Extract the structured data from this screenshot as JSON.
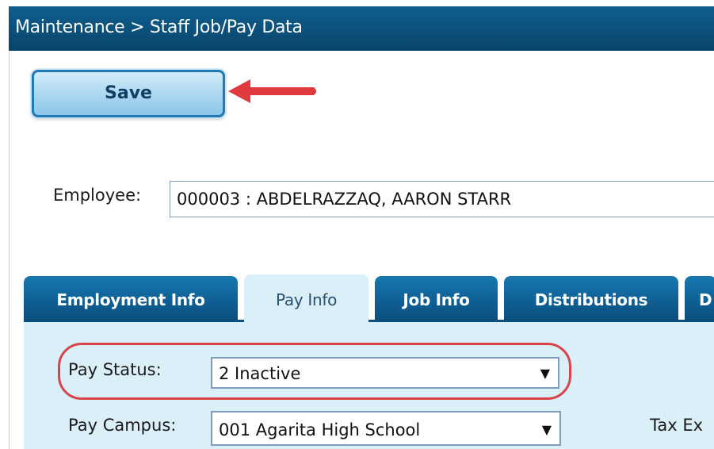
{
  "titlebar": {
    "breadcrumb": "Maintenance > Staff Job/Pay Data"
  },
  "toolbar": {
    "save_label": "Save"
  },
  "employee": {
    "label": "Employee:",
    "value": "000003 : ABDELRAZZAQ, AARON STARR"
  },
  "tabs": [
    {
      "label": "Employment Info",
      "active": false
    },
    {
      "label": "Pay Info",
      "active": true
    },
    {
      "label": "Job Info",
      "active": false
    },
    {
      "label": "Distributions",
      "active": false
    },
    {
      "label": "D",
      "active": false
    }
  ],
  "pay_info": {
    "pay_status": {
      "label": "Pay Status:",
      "value": "2 Inactive"
    },
    "pay_campus": {
      "label": "Pay Campus:",
      "value": "001 Agarita High School"
    },
    "tax_exempt": {
      "label": "Tax Ex"
    }
  },
  "icons": {
    "dropdown": "▼",
    "annotation_arrow": "red-arrow-icon"
  },
  "colors": {
    "header": "#0b4f79",
    "tab": "#0e5e93",
    "content_bg": "#dbeff9",
    "annotation": "#d9434a"
  }
}
